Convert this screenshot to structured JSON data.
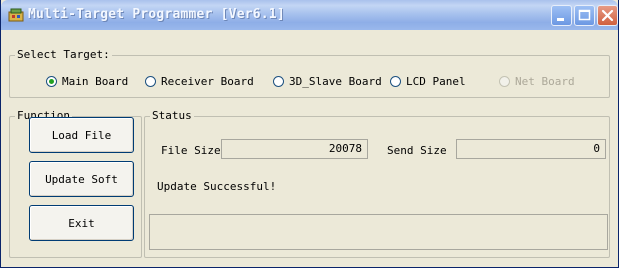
{
  "window": {
    "title": "Multi-Target Programmer [Ver6.1]"
  },
  "select_target": {
    "title": "Select Target:",
    "options": [
      {
        "label": "Main Board",
        "selected": true,
        "enabled": true
      },
      {
        "label": "Receiver Board",
        "selected": false,
        "enabled": true
      },
      {
        "label": "3D_Slave Board",
        "selected": false,
        "enabled": true
      },
      {
        "label": "LCD Panel",
        "selected": false,
        "enabled": true
      },
      {
        "label": "Net Board",
        "selected": false,
        "enabled": false
      }
    ]
  },
  "function": {
    "title": "Function",
    "buttons": [
      "Load File",
      "Update Soft",
      "Exit"
    ]
  },
  "status": {
    "title": "Status",
    "file_size_label": "File Size:",
    "file_size_value": "20078",
    "send_size_label": "Send Size",
    "send_size_value": "0",
    "message": "Update Successful!",
    "progress_value": 0
  },
  "icons": {
    "app": "programmer-chip-icon",
    "minimize": "minimize-icon",
    "maximize": "maximize-icon",
    "close": "close-icon"
  },
  "colors": {
    "title_bar": "#a8c2ee",
    "close_button": "#d0603f",
    "window_face": "#ece9d8",
    "radio_selected": "#21a121"
  }
}
